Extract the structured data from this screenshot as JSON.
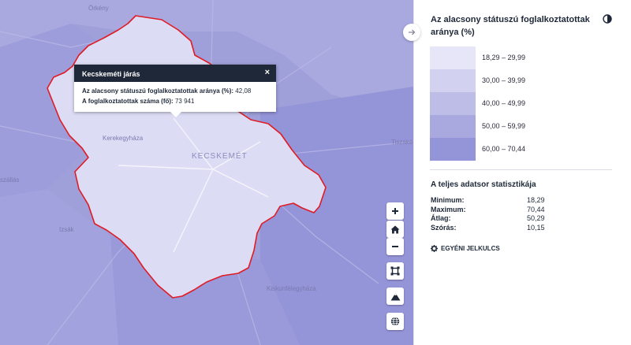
{
  "map": {
    "places": {
      "orkeny": "Örkény",
      "kerekegyhaza": "Kerekegyháza",
      "kecskemet": "KECSKEMÉT",
      "tiszakecske": "Tiszakécske",
      "szallas": "szállás",
      "izsak": "Izsák",
      "kiskunfelegyhaza": "Kiskunfélegyháza"
    },
    "popup": {
      "title": "Kecskeméti járás",
      "close": "×",
      "row1_label": "Az alacsony státuszú foglalkoztatottak aránya (%):",
      "row1_value": "42,08",
      "row2_label": "A foglalkoztatottak száma (fő):",
      "row2_value": "73 941"
    },
    "controls": [
      "zoom-in",
      "home",
      "zoom-out",
      "fit-bounds",
      "terrain",
      "globe"
    ],
    "colors": {
      "background": "#9f9fd9",
      "selected_fill": "#dcdcf4",
      "selected_border": "#e01b24"
    }
  },
  "panel": {
    "title": "Az alacsony státuszú foglalkoztatottak aránya (%)",
    "legend": [
      {
        "label": "18,29 – 29,99",
        "color": "#e6e6f8"
      },
      {
        "label": "30,00 – 39,99",
        "color": "#d2d2f0"
      },
      {
        "label": "40,00 – 49,99",
        "color": "#bdbde8"
      },
      {
        "label": "50,00 – 59,99",
        "color": "#a9a9e0"
      },
      {
        "label": "60,00 – 70,44",
        "color": "#9494d8"
      }
    ],
    "stats_title": "A teljes adatsor statisztikája",
    "stats": [
      {
        "label": "Minimum:",
        "value": "18,29"
      },
      {
        "label": "Maximum:",
        "value": "70,44"
      },
      {
        "label": "Átlag:",
        "value": "50,29"
      },
      {
        "label": "Szórás:",
        "value": "10,15"
      }
    ],
    "custom_legend_label": "EGYÉNI JELKULCS"
  }
}
